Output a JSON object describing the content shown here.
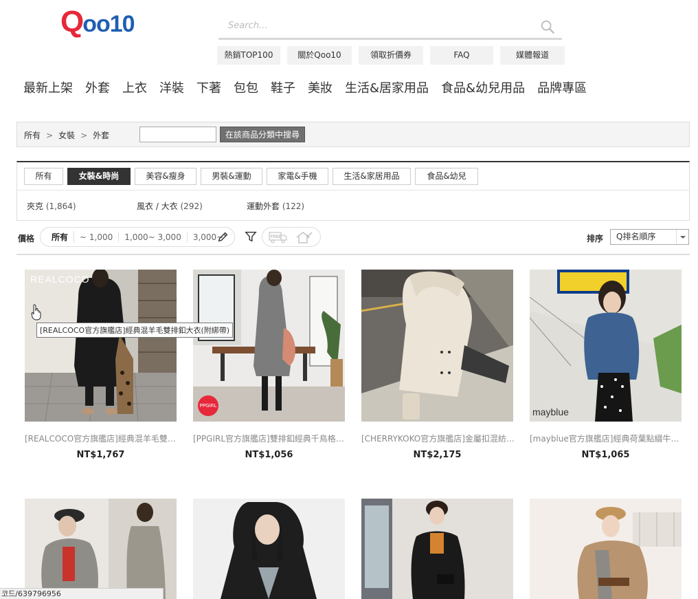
{
  "logo": {
    "q": "Q",
    "rest": "oo10"
  },
  "search": {
    "placeholder": "Search..."
  },
  "quick_links": [
    {
      "label": "熱銷TOP100"
    },
    {
      "label": "關於Qoo10"
    },
    {
      "label": "領取折價券"
    },
    {
      "label": "FAQ"
    },
    {
      "label": "媒體報道"
    }
  ],
  "categories": [
    "最新上架",
    "外套",
    "上衣",
    "洋裝",
    "下著",
    "包包",
    "鞋子",
    "美妝",
    "生活&居家用品",
    "食品&幼兒用品",
    "品牌專區"
  ],
  "breadcrumb": [
    "所有",
    "女裝",
    "外套"
  ],
  "breadcrumb_sep": ">",
  "category_search_button": "在該商品分類中搜尋",
  "tabs": [
    {
      "label": "所有",
      "active": false
    },
    {
      "label": "女裝&時尚",
      "active": true
    },
    {
      "label": "美容&瘦身",
      "active": false
    },
    {
      "label": "男裝&運動",
      "active": false
    },
    {
      "label": "家電&手機",
      "active": false
    },
    {
      "label": "生活&家居用品",
      "active": false
    },
    {
      "label": "食品&幼兒",
      "active": false
    }
  ],
  "subcategories": [
    {
      "name": "夾克 ",
      "count": "(1,864)"
    },
    {
      "name": "風衣 / 大衣 ",
      "count": "(292)"
    },
    {
      "name": "運動外套 ",
      "count": "(122)"
    }
  ],
  "filters": {
    "price_label": "價格",
    "price_options": [
      "所有",
      "~ 1,000",
      "1,000~ 3,000",
      "3,000~"
    ],
    "price_selected": "所有",
    "sort_label": "排序",
    "sort_value": "Q排名順序",
    "free_label": "FREE"
  },
  "products": [
    {
      "name": "[REALCOCO官方旗艦店]經典混羊毛雙排釦大衣(附綁帶)",
      "price": "NT$1,767",
      "brand_tag": "REALCOCO"
    },
    {
      "name": "[PPGIRL官方旗艦店]雙排釦經典千鳥格紋大衣",
      "price": "NT$1,056",
      "brand_tag": "PPGIRL"
    },
    {
      "name": "[CHERRYKOKO官方旗艦店]金屬扣混紡連帽外套",
      "price": "NT$2,175",
      "brand_tag": ""
    },
    {
      "name": "[mayblue官方旗艦店]經典荷葉點綴牛仔外套",
      "price": "NT$1,065",
      "brand_tag": "mayblue"
    }
  ],
  "tooltip": "[REALCOCO官方旗艦店]經典混羊毛雙排釦大衣(附綁帶)",
  "status_bar": "코드/639796956",
  "colors": {
    "logo_red": "#e6283a",
    "logo_blue": "#1f5fb3",
    "active_tab": "#333333"
  }
}
